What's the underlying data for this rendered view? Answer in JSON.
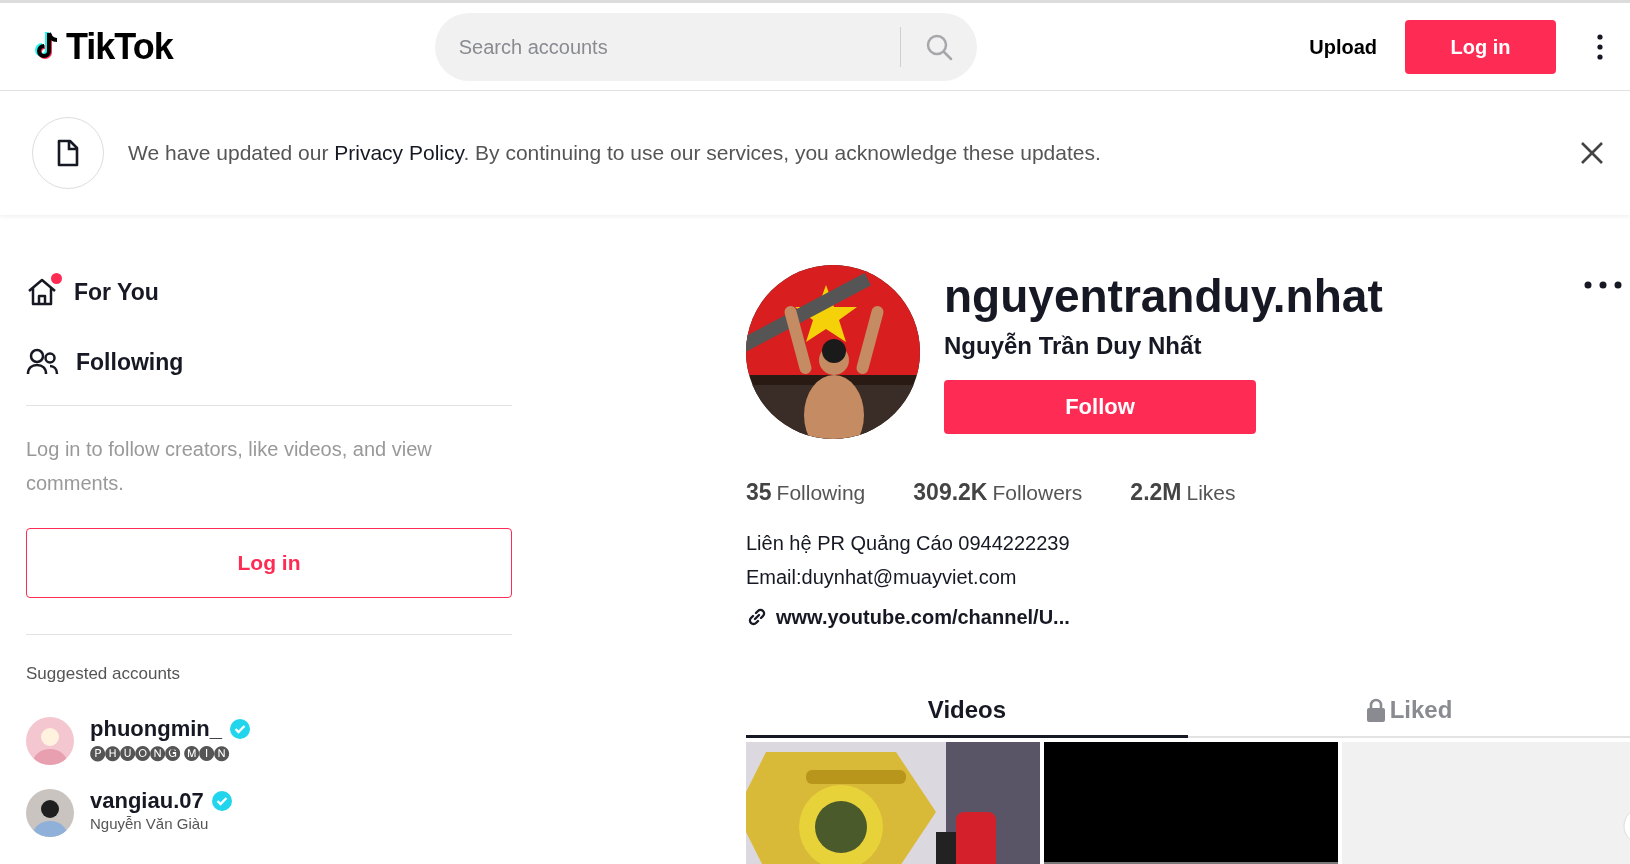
{
  "header": {
    "logo": "TikTok",
    "search": {
      "placeholder": "Search accounts"
    },
    "upload": "Upload",
    "login": "Log in"
  },
  "banner": {
    "before": "We have updated our",
    "link": "Privacy Policy",
    "after": ". By continuing to use our services, you acknowledge these updates."
  },
  "sidebar": {
    "nav": [
      {
        "kind": "home",
        "label": "For You",
        "badge": true
      },
      {
        "kind": "people",
        "label": "Following",
        "badge": false
      }
    ],
    "prompt": "Log in to follow creators, like videos, and view comments.",
    "login": "Log in",
    "suggested_title": "Suggested accounts",
    "suggested": [
      {
        "username": "phuongmin_",
        "display_name": "🅟🅗🅤🅞🅝🅖 🅜🅘🅝",
        "verified": true
      },
      {
        "username": "vangiau.07",
        "display_name": "Nguyễn Văn Giàu",
        "verified": true
      }
    ]
  },
  "profile": {
    "username": "nguyentranduy.nhat",
    "display_name": "Nguyễn Trần Duy Nhất",
    "follow": "Follow",
    "stats": [
      {
        "value": "35",
        "label": "Following"
      },
      {
        "value": "309.2K",
        "label": "Followers"
      },
      {
        "value": "2.2M",
        "label": "Likes"
      }
    ],
    "bio": [
      "Liên hệ PR Quảng Cáo 0944222239",
      "Email:duynhat@muayviet.com"
    ],
    "link": "www.youtube.com/channel/U...",
    "tabs": [
      {
        "label": "Videos",
        "selected": true,
        "locked": false
      },
      {
        "label": "Liked",
        "selected": false,
        "locked": true
      }
    ],
    "videos": [
      {
        "kind": "picture"
      },
      {
        "kind": "picture"
      },
      {
        "kind": "picture"
      }
    ]
  }
}
